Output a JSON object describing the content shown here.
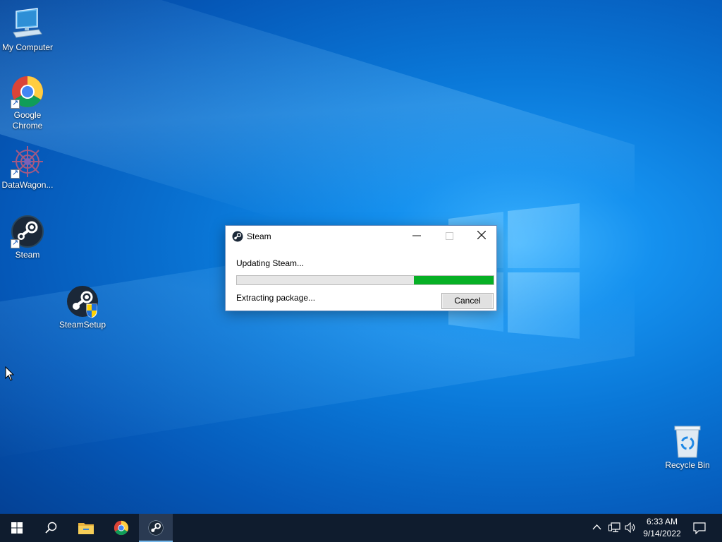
{
  "desktop": {
    "icons": [
      {
        "label": "My Computer"
      },
      {
        "label": "Google Chrome"
      },
      {
        "label": "DataWagon..."
      },
      {
        "label": "Steam"
      },
      {
        "label": "SteamSetup"
      },
      {
        "label": "Recycle Bin"
      }
    ]
  },
  "dialog": {
    "title": "Steam",
    "status_line": "Updating Steam...",
    "detail_line": "Extracting package...",
    "cancel_label": "Cancel",
    "progress_percent": 31,
    "progress_color": "#06b025"
  },
  "taskbar": {
    "items": [
      "start-icon",
      "search-icon",
      "file-explorer-icon",
      "chrome-icon",
      "steam-icon"
    ],
    "active_item": "steam-icon",
    "clock": {
      "time": "6:33 AM",
      "date": "9/14/2022"
    },
    "tray_icons": [
      "chevron-up-icon",
      "network-icon",
      "volume-icon",
      "notification-icon"
    ]
  },
  "colors": {
    "taskbar": "#0f1c2e",
    "desktop_accent": "#0a78d8"
  }
}
